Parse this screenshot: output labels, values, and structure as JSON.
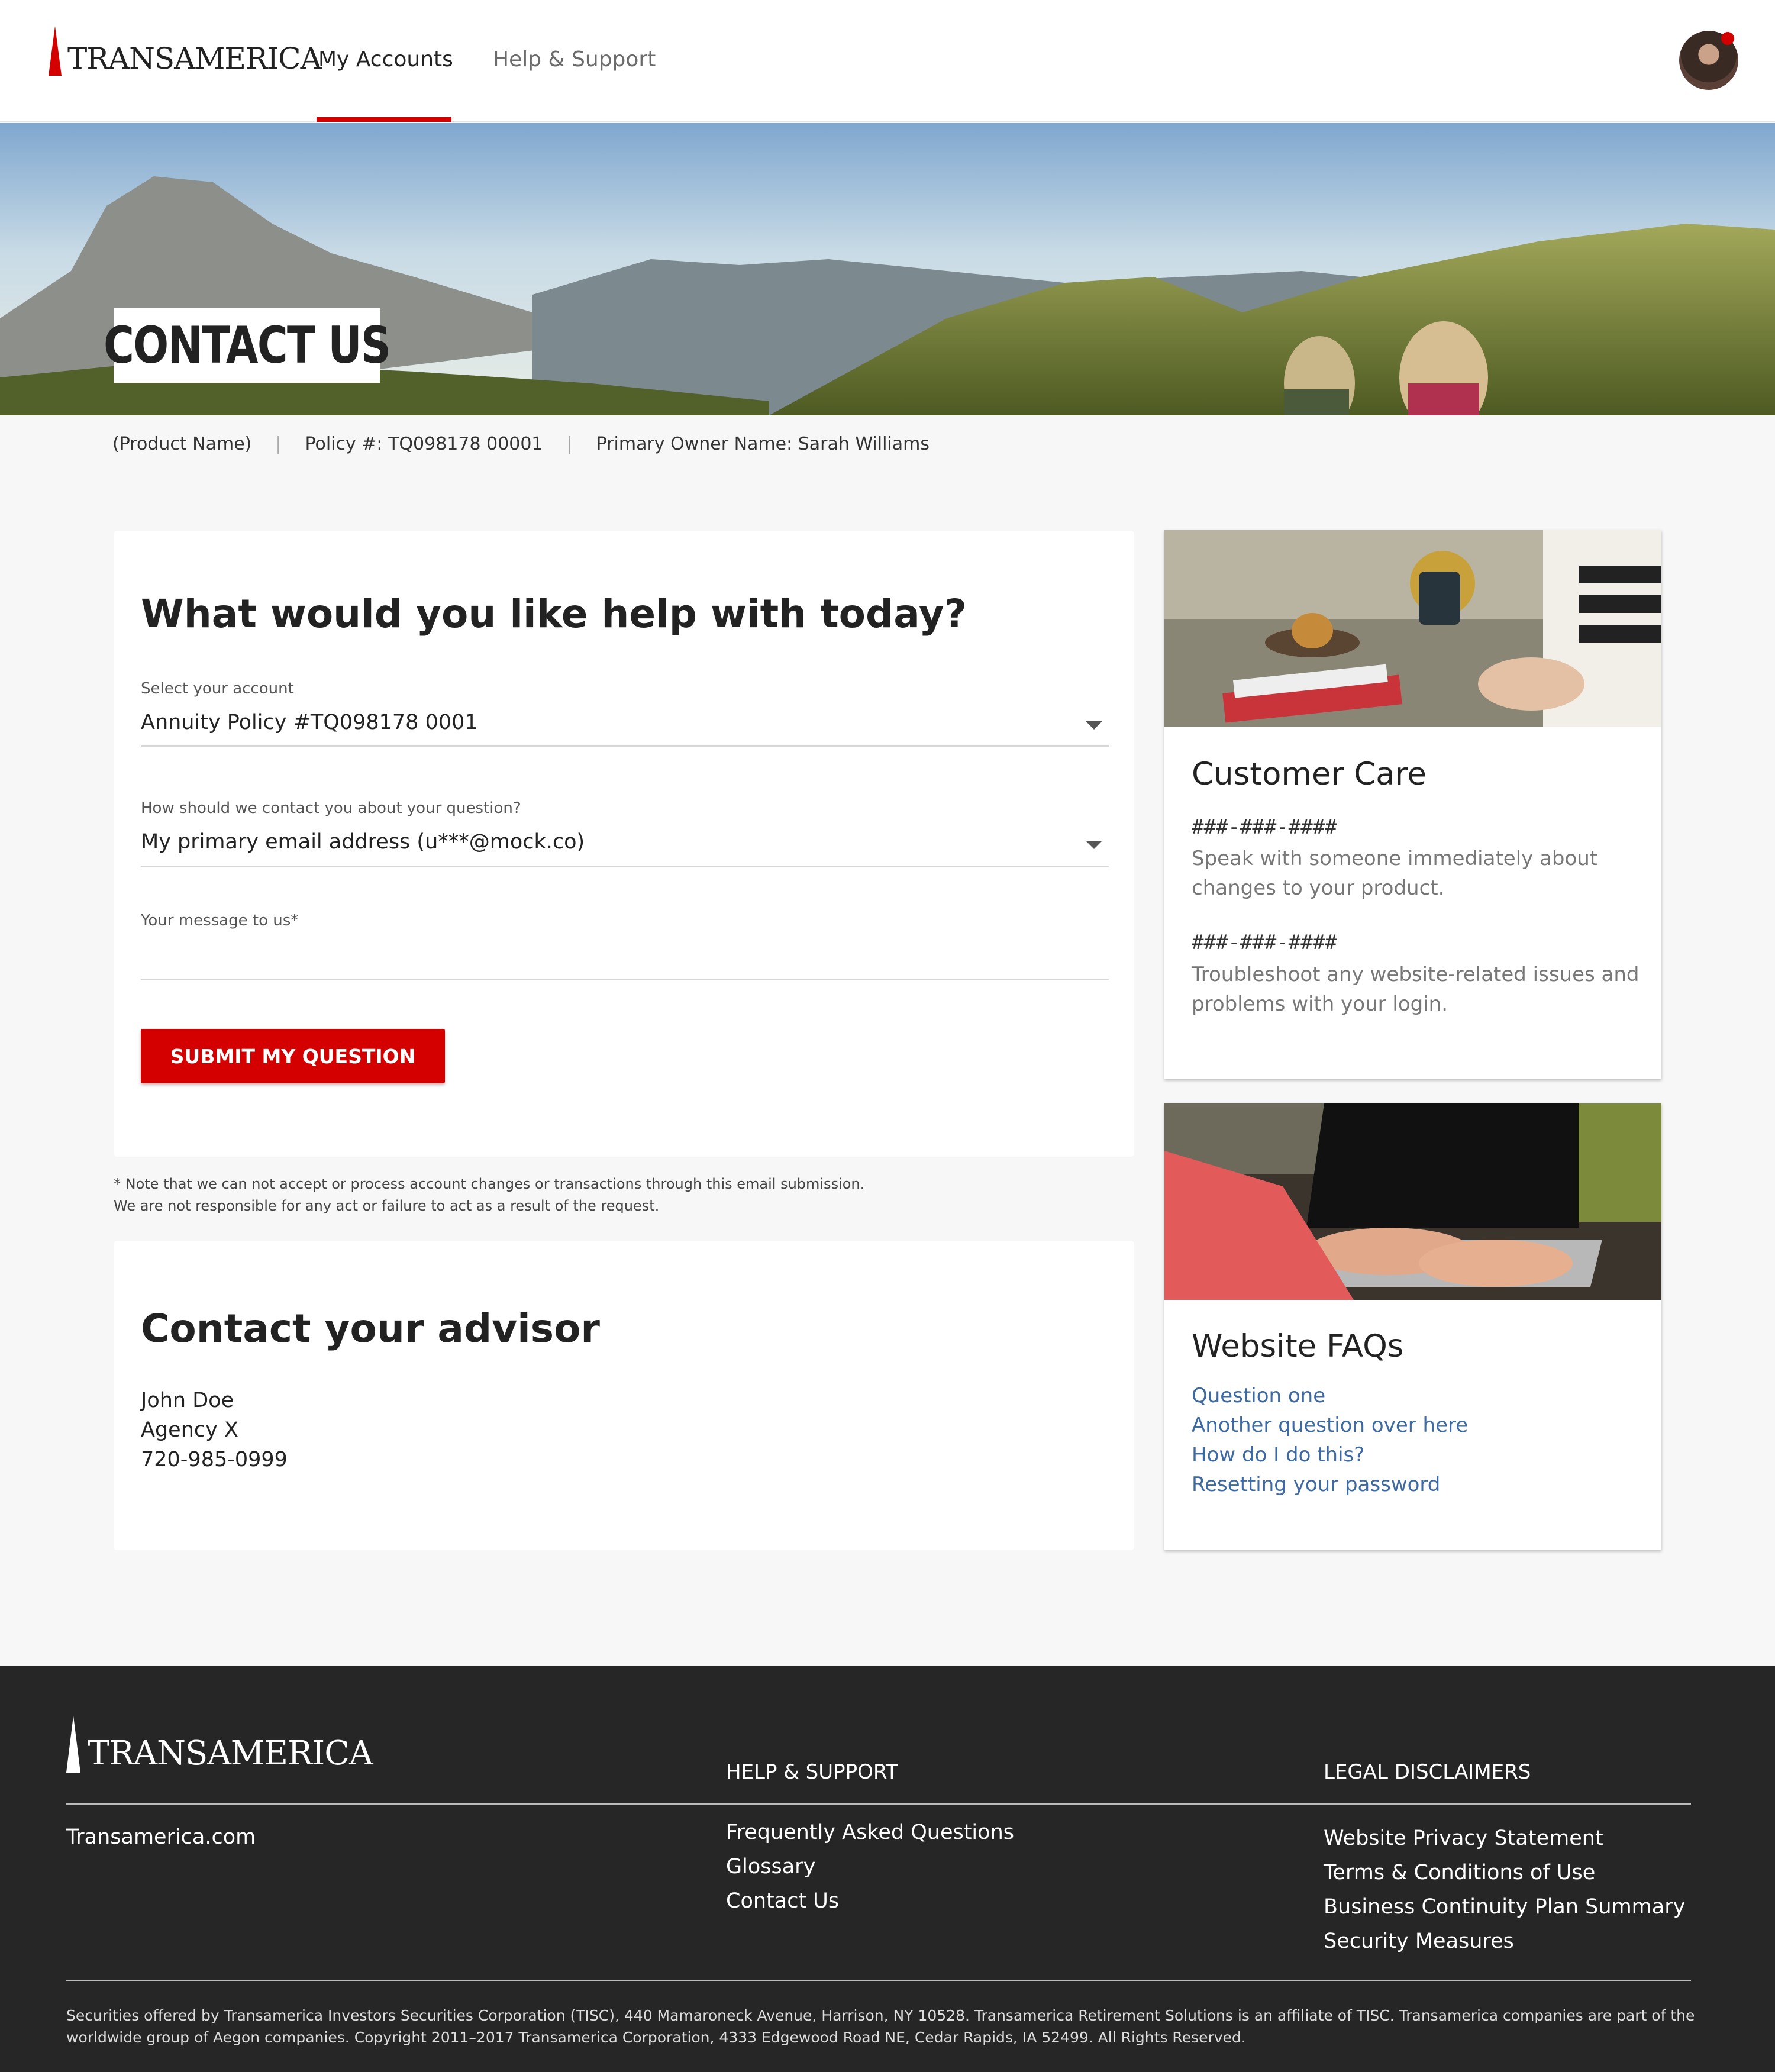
{
  "header": {
    "logo_text": "TRANSAMERICA",
    "nav": [
      {
        "label": "My Accounts",
        "active": true
      },
      {
        "label": "Help & Support",
        "active": false
      }
    ],
    "accent_color": "#d40000"
  },
  "hero": {
    "title": "CONTACT US"
  },
  "policy_bar": {
    "product": "(Product Name)",
    "separator": "|",
    "policy": "Policy #: TQ098178 00001",
    "owner": "Primary Owner Name: Sarah Williams"
  },
  "help_form": {
    "heading": "What would you like help with today?",
    "account_label": "Select your account",
    "account_value": "Annuity Policy #TQ098178 0001",
    "contact_label": "How should we contact you about your question?",
    "contact_value": "My primary email address (u***@mock.co)",
    "message_label": "Your message to us*",
    "submit_label": "SUBMIT MY QUESTION"
  },
  "note": {
    "line1": "* Note that we can not accept or process account changes or transactions through this email submission.",
    "line2": "We are not responsible for any act or failure to act as a result of the request."
  },
  "advisor": {
    "heading": "Contact your advisor",
    "name": "John Doe",
    "agency": "Agency X",
    "phone": "720-985-0999"
  },
  "customer_care": {
    "title": "Customer Care",
    "phone1": "###-###-####",
    "desc1": "Speak with someone immediately about changes to your product.",
    "phone2": "###-###-####",
    "desc2": "Troubleshoot any website-related issues and problems with your login."
  },
  "faqs": {
    "title": "Website FAQs",
    "links": [
      "Question one",
      "Another question over here",
      "How do I do this?",
      "Resetting your password"
    ]
  },
  "footer": {
    "logo_text": "TRANSAMERICA",
    "site_link": "Transamerica.com",
    "help_heading": "HELP & SUPPORT",
    "help_links": [
      "Frequently Asked Questions",
      "Glossary",
      "Contact Us"
    ],
    "legal_heading": "LEGAL DISCLAIMERS",
    "legal_links": [
      "Website Privacy Statement",
      "Terms & Conditions of Use",
      "Business Continuity Plan Summary",
      "Security Measures"
    ],
    "disclaimer": "Securities offered by Transamerica Investors Securities Corporation (TISC), 440 Mamaroneck Avenue, Harrison, NY 10528. Transamerica Retirement Solutions is an affiliate of TISC. Transamerica companies are part of the worldwide group of Aegon companies. Copyright 2011–2017 Transamerica Corporation, 4333 Edgewood Road NE, Cedar Rapids, IA 52499. All Rights Reserved."
  }
}
